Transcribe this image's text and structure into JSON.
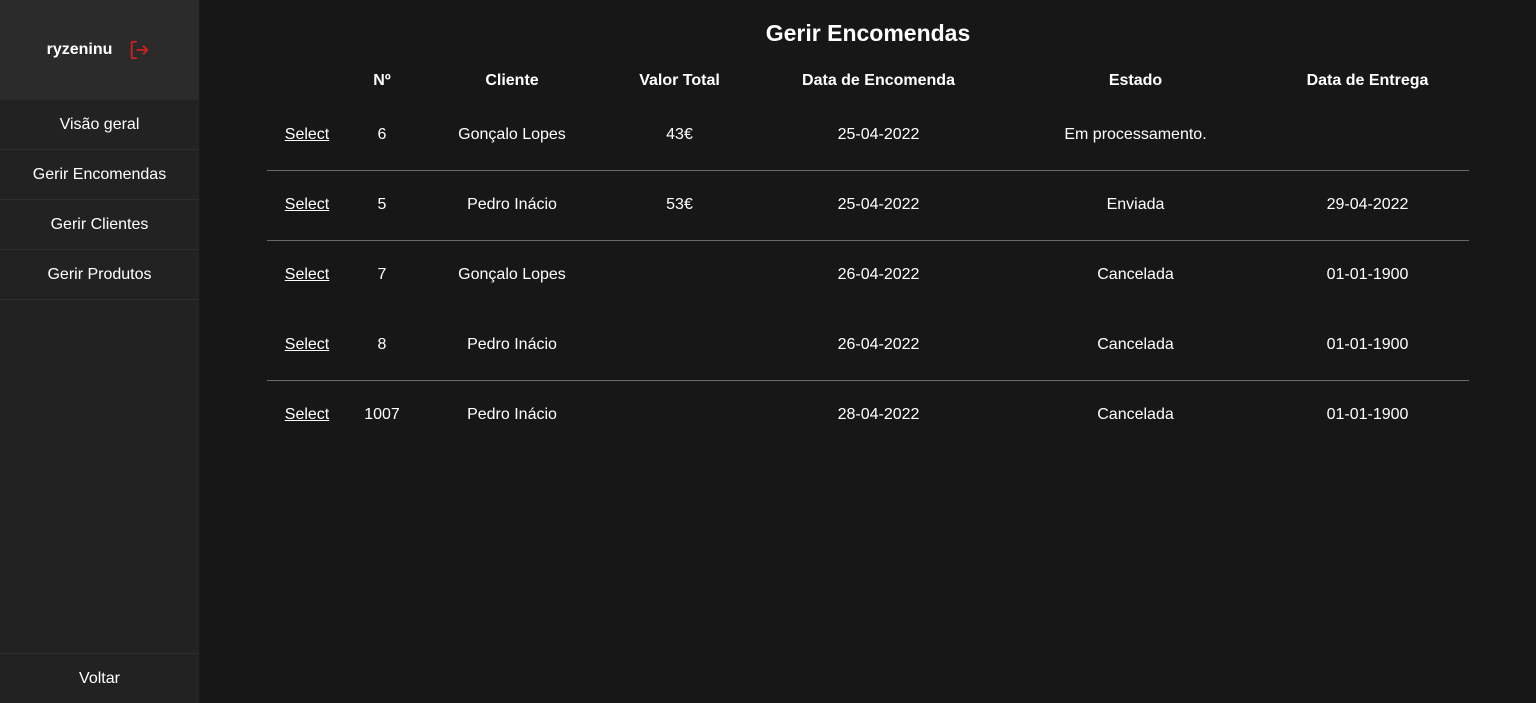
{
  "sidebar": {
    "username": "ryzeninu",
    "logout_icon": "logout-icon",
    "accent": "#d21f1f",
    "items": [
      {
        "label": "Visão geral"
      },
      {
        "label": "Gerir Encomendas"
      },
      {
        "label": "Gerir Clientes"
      },
      {
        "label": "Gerir Produtos"
      }
    ],
    "back_label": "Voltar"
  },
  "main": {
    "title": "Gerir Encomendas",
    "table": {
      "headers": [
        "",
        "Nº",
        "Cliente",
        "Valor Total",
        "Data de Encomenda",
        "Estado",
        "Data de Entrega"
      ],
      "rows": [
        {
          "action": "Select",
          "num": "6",
          "cliente": "Gonçalo Lopes",
          "valor": "43€",
          "data_encomenda": "25-04-2022",
          "estado": "Em processamento.",
          "data_entrega": ""
        },
        {
          "action": "Select",
          "num": "5",
          "cliente": "Pedro Inácio",
          "valor": "53€",
          "data_encomenda": "25-04-2022",
          "estado": "Enviada",
          "data_entrega": "29-04-2022"
        },
        {
          "action": "Select",
          "num": "7",
          "cliente": "Gonçalo Lopes",
          "valor": "",
          "data_encomenda": "26-04-2022",
          "estado": "Cancelada",
          "data_entrega": "01-01-1900"
        },
        {
          "action": "Select",
          "num": "8",
          "cliente": "Pedro Inácio",
          "valor": "",
          "data_encomenda": "26-04-2022",
          "estado": "Cancelada",
          "data_entrega": "01-01-1900"
        },
        {
          "action": "Select",
          "num": "1007",
          "cliente": "Pedro Inácio",
          "valor": "",
          "data_encomenda": "28-04-2022",
          "estado": "Cancelada",
          "data_entrega": "01-01-1900"
        }
      ]
    }
  }
}
